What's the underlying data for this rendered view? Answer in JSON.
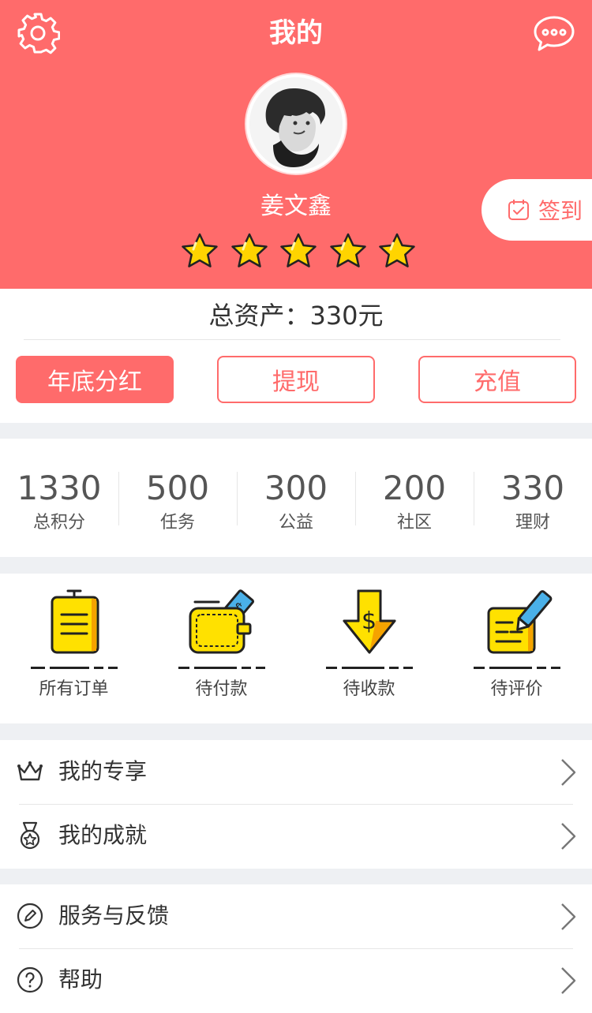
{
  "header": {
    "title": "我的",
    "username": "姜文鑫",
    "rating_stars": 5,
    "signin_label": "签到"
  },
  "assets": {
    "total_label": "总资产：",
    "total_value": "330元",
    "buttons": [
      "年底分红",
      "提现",
      "充值"
    ]
  },
  "stats": [
    {
      "value": "1330",
      "label": "总积分"
    },
    {
      "value": "500",
      "label": "任务"
    },
    {
      "value": "300",
      "label": "公益"
    },
    {
      "value": "200",
      "label": "社区"
    },
    {
      "value": "330",
      "label": "理财"
    }
  ],
  "orders": [
    {
      "label": "所有订单",
      "icon": "clipboard-icon"
    },
    {
      "label": "待付款",
      "icon": "wallet-icon"
    },
    {
      "label": "待收款",
      "icon": "download-dollar-icon"
    },
    {
      "label": "待评价",
      "icon": "note-pencil-icon"
    }
  ],
  "menu_group_1": [
    {
      "label": "我的专享",
      "icon": "crown-icon"
    },
    {
      "label": "我的成就",
      "icon": "medal-icon"
    }
  ],
  "menu_group_2": [
    {
      "label": "服务与反馈",
      "icon": "feedback-pencil-icon"
    },
    {
      "label": "帮助",
      "icon": "help-icon"
    }
  ],
  "colors": {
    "brand": "#ff6b6b",
    "star": "#ffd400",
    "order_yellow": "#ffe100",
    "order_blue": "#4ab0e8"
  }
}
